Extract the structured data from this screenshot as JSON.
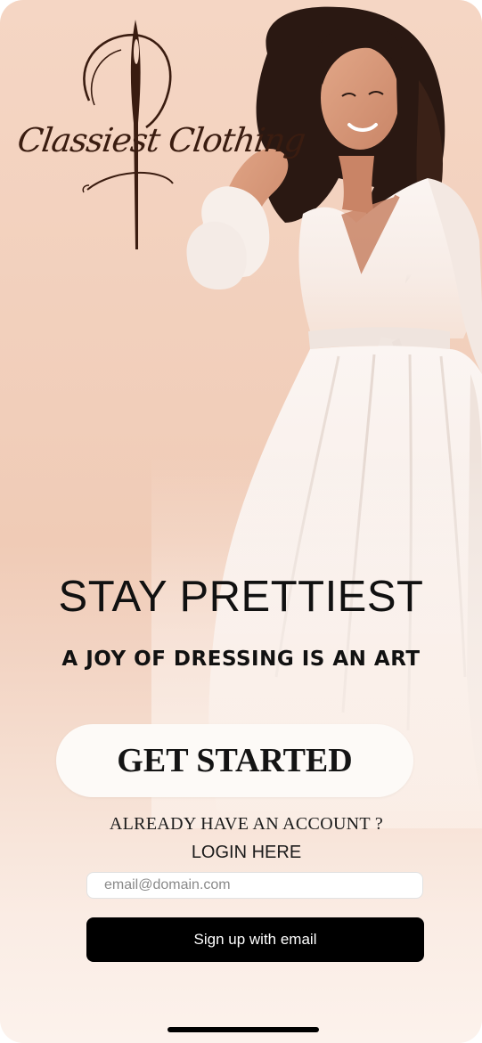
{
  "brand": {
    "name": "Classiest Clothing",
    "logo_icon": "needle-and-thread-icon"
  },
  "hero": {
    "image": "woman-in-white-dress-illustration",
    "headline": "STAY PRETTIEST",
    "tagline": "A JOY OF DRESSING IS AN ART"
  },
  "actions": {
    "get_started_label": "GET STARTED",
    "already_have_account": "ALREADY HAVE AN ACCOUNT ?",
    "login_label": "LOGIN HERE"
  },
  "signup": {
    "email_placeholder": "email@domain.com",
    "email_value": "",
    "button_label": "Sign up with email"
  },
  "colors": {
    "background_top": "#f5d6c4",
    "background_bottom": "#fcf2ec",
    "primary_button": "#000000",
    "cta_button": "#fdfaf7",
    "logo": "#3a1c10"
  }
}
